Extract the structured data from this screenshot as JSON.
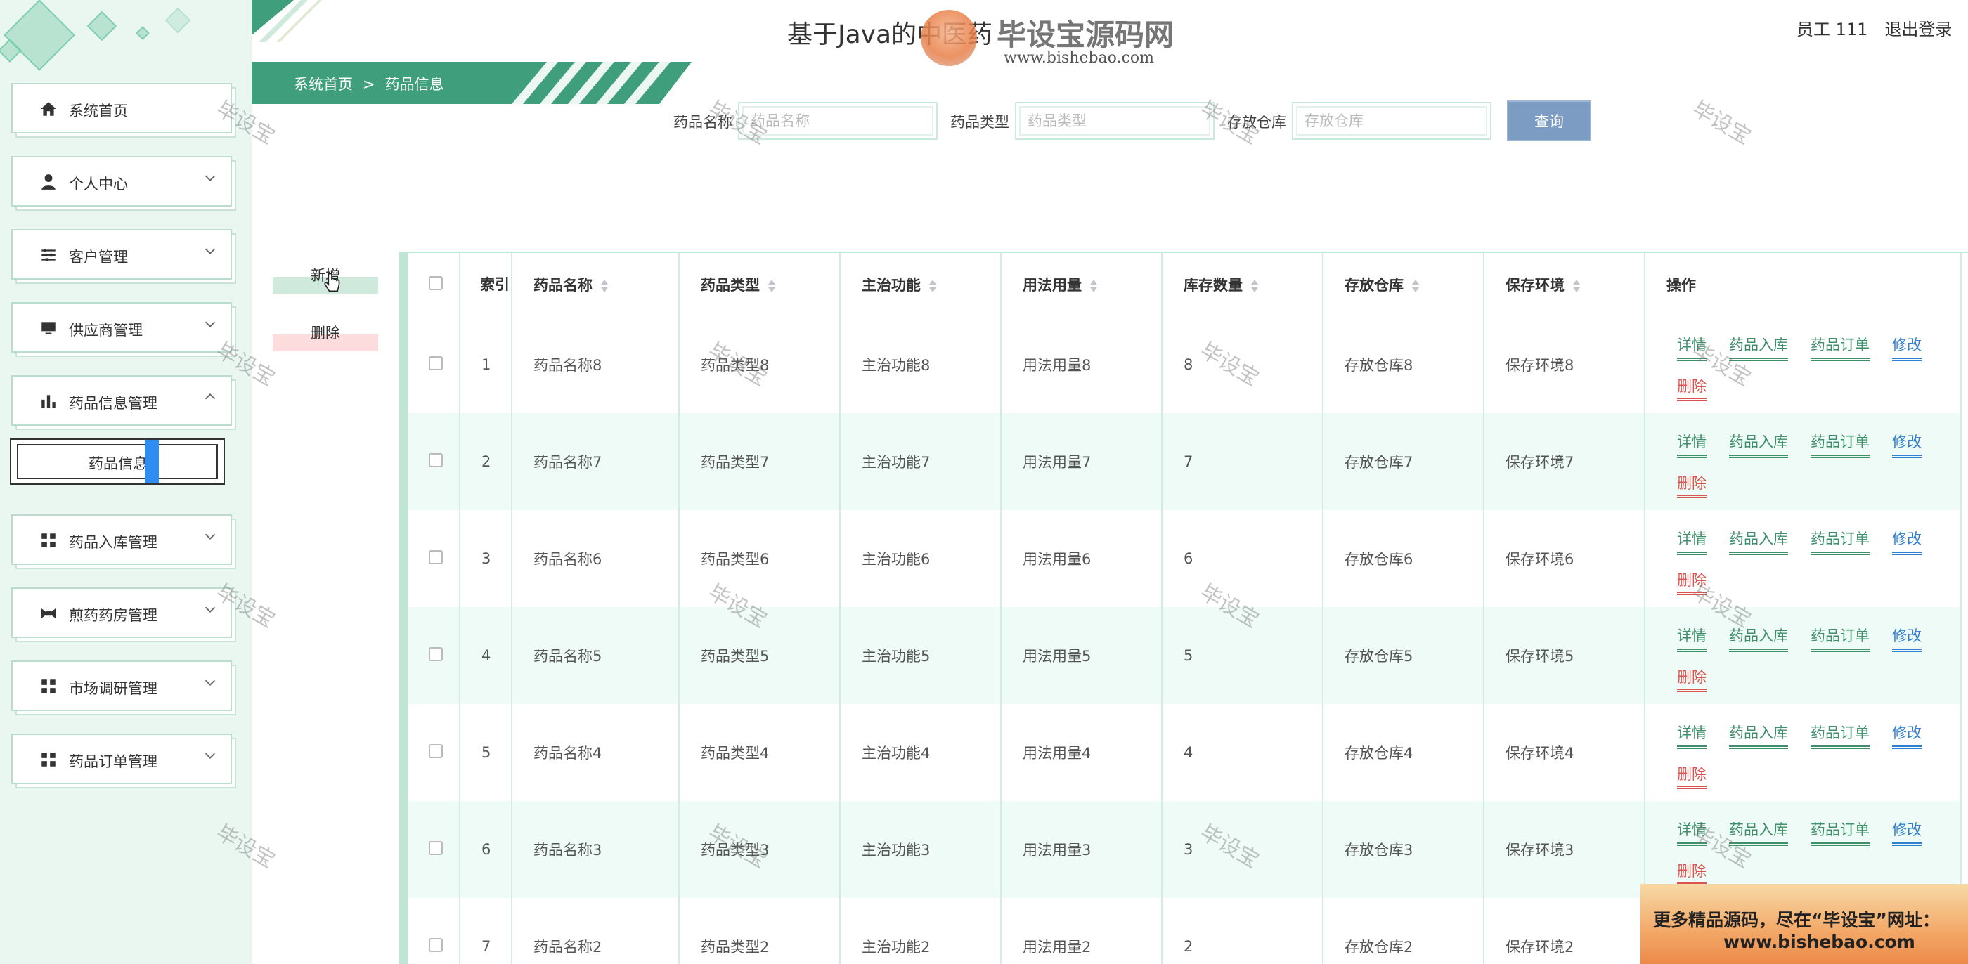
{
  "header": {
    "title": "基于Java的中医药",
    "watermark_brand": "毕设宝源码网",
    "watermark_url": "www.bishebao.com",
    "user_label": "员工 111",
    "logout_label": "退出登录"
  },
  "breadcrumb": {
    "home": "系统首页",
    "separator": ">",
    "current": "药品信息"
  },
  "sidebar": {
    "items": [
      {
        "label": "系统首页",
        "icon": "home-icon",
        "has_chevron": false
      },
      {
        "label": "个人中心",
        "icon": "user-icon",
        "has_chevron": true
      },
      {
        "label": "客户管理",
        "icon": "sliders-icon",
        "has_chevron": true
      },
      {
        "label": "供应商管理",
        "icon": "monitor-icon",
        "has_chevron": true
      },
      {
        "label": "药品信息管理",
        "icon": "bar-chart-icon",
        "has_chevron": true
      },
      {
        "label": "药品入库管理",
        "icon": "grid-icon",
        "has_chevron": true
      },
      {
        "label": "煎药药房管理",
        "icon": "bowtie-icon",
        "has_chevron": true
      },
      {
        "label": "市场调研管理",
        "icon": "grid-icon",
        "has_chevron": true
      },
      {
        "label": "药品订单管理",
        "icon": "grid-icon",
        "has_chevron": true
      }
    ],
    "sub_item": {
      "label": "药品信息"
    }
  },
  "search": {
    "name_label": "药品名称",
    "name_placeholder": "药品名称",
    "type_label": "药品类型",
    "type_placeholder": "药品类型",
    "warehouse_label": "存放仓库",
    "warehouse_placeholder": "存放仓库",
    "query_label": "查询"
  },
  "actions": {
    "add_label": "新增",
    "delete_label": "删除"
  },
  "table": {
    "columns": {
      "index": "索引",
      "name": "药品名称",
      "type": "药品类型",
      "function": "主治功能",
      "usage": "用法用量",
      "stock": "库存数量",
      "warehouse": "存放仓库",
      "environment": "保存环境",
      "ops": "操作"
    },
    "op_labels": {
      "detail": "详情",
      "inbound": "药品入库",
      "order": "药品订单",
      "edit": "修改",
      "delete": "删除"
    },
    "rows": [
      {
        "idx": "1",
        "name": "药品名称8",
        "type": "药品类型8",
        "function": "主治功能8",
        "usage": "用法用量8",
        "stock": "8",
        "warehouse": "存放仓库8",
        "environment": "保存环境8"
      },
      {
        "idx": "2",
        "name": "药品名称7",
        "type": "药品类型7",
        "function": "主治功能7",
        "usage": "用法用量7",
        "stock": "7",
        "warehouse": "存放仓库7",
        "environment": "保存环境7"
      },
      {
        "idx": "3",
        "name": "药品名称6",
        "type": "药品类型6",
        "function": "主治功能6",
        "usage": "用法用量6",
        "stock": "6",
        "warehouse": "存放仓库6",
        "environment": "保存环境6"
      },
      {
        "idx": "4",
        "name": "药品名称5",
        "type": "药品类型5",
        "function": "主治功能5",
        "usage": "用法用量5",
        "stock": "5",
        "warehouse": "存放仓库5",
        "environment": "保存环境5"
      },
      {
        "idx": "5",
        "name": "药品名称4",
        "type": "药品类型4",
        "function": "主治功能4",
        "usage": "用法用量4",
        "stock": "4",
        "warehouse": "存放仓库4",
        "environment": "保存环境4"
      },
      {
        "idx": "6",
        "name": "药品名称3",
        "type": "药品类型3",
        "function": "主治功能3",
        "usage": "用法用量3",
        "stock": "3",
        "warehouse": "存放仓库3",
        "environment": "保存环境3"
      },
      {
        "idx": "7",
        "name": "药品名称2",
        "type": "药品类型2",
        "function": "主治功能2",
        "usage": "用法用量2",
        "stock": "2",
        "warehouse": "存放仓库2",
        "environment": "保存环境2"
      }
    ]
  },
  "watermark_text": "毕设宝",
  "ad": {
    "line1": "更多精品源码，尽在“毕设宝”网址：",
    "line2": "www.bishebao.com"
  },
  "colors": {
    "accent": "#3cb48a",
    "sidebar_bg": "#eaf7f1",
    "query_button": "#7d9cc4",
    "row_stripe": "#eefbf6"
  }
}
